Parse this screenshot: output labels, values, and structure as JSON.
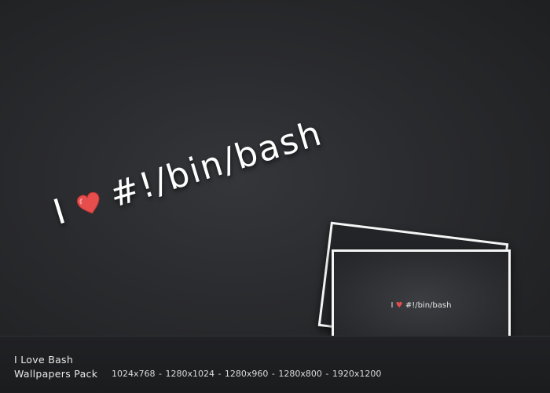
{
  "hero": {
    "pre": "I",
    "text": "#!/bin/bash",
    "heart_color": "#e64d4d"
  },
  "preview": {
    "pre": "I",
    "text": "#!/bin/bash"
  },
  "footer": {
    "title": "I Love Bash",
    "subtitle": "Wallpapers Pack",
    "resolutions": "1024x768 - 1280x1024 - 1280x960 - 1280x800 - 1920x1200"
  },
  "icons": [
    "heart-icon"
  ]
}
